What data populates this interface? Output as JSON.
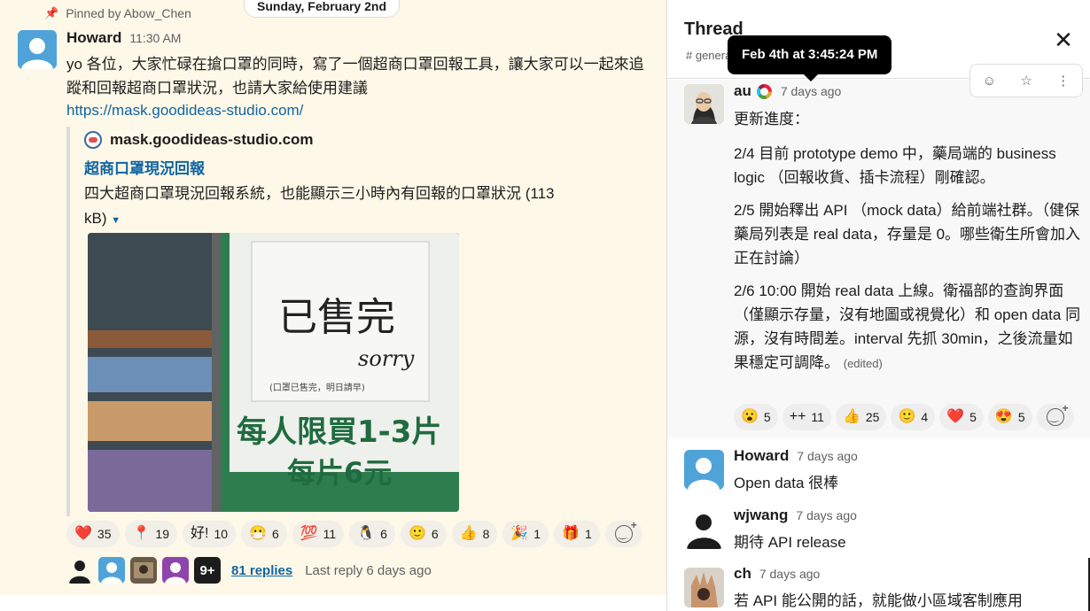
{
  "channel": {
    "pinned_by": "Pinned by Abow_Chen",
    "date_divider": "Sunday, February 2nd",
    "message": {
      "author": "Howard",
      "time": "11:30 AM",
      "text": "yo 各位，大家忙碌在搶口罩的同時，寫了一個超商口罩回報工具，讓大家可以一起來追蹤和回報超商口罩狀況，也請大家給使用建議",
      "link": "https://mask.goodideas-studio.com/"
    },
    "unfurl": {
      "site": "mask.goodideas-studio.com",
      "title": "超商口罩現況回報",
      "description": "四大超商口罩現況回報系統，也能顯示三小時內有回報的口罩狀況",
      "size": "(113 kB)",
      "image_sign": {
        "sold_out": "已售完",
        "sorry": "sorry",
        "note": "(口罩已售完，明日請早)",
        "limit": "每人限買1-3片",
        "price": "每片6元"
      }
    },
    "reactions": [
      {
        "icon": "heart",
        "emoji": "❤️",
        "count": "35"
      },
      {
        "icon": "pushpin-red",
        "emoji": "📍",
        "count": "19"
      },
      {
        "icon": "good-text",
        "emoji": "好!",
        "count": "10"
      },
      {
        "icon": "face-mask-globe",
        "emoji": "😷",
        "count": "6"
      },
      {
        "icon": "hundred",
        "emoji": "💯",
        "count": "11"
      },
      {
        "icon": "penguin",
        "emoji": "🐧",
        "count": "6"
      },
      {
        "icon": "slightly-smiling",
        "emoji": "🙂",
        "count": "6"
      },
      {
        "icon": "thumbs-up",
        "emoji": "👍",
        "count": "8"
      },
      {
        "icon": "party-hat",
        "emoji": "🎉",
        "count": "1"
      },
      {
        "icon": "gift",
        "emoji": "🎁",
        "count": "1"
      }
    ],
    "replies": {
      "more_count": "9+",
      "link": "81 replies",
      "last": "Last reply 6 days ago"
    }
  },
  "thread": {
    "title": "Thread",
    "channel": "# general",
    "tooltip": "Feb 4th at 3:45:24 PM",
    "parent": {
      "author": "au",
      "time": "7 days ago",
      "lines": [
        "更新進度：",
        "2/4 目前 prototype demo 中，藥局端的 business logic （回報收貨、插卡流程）剛確認。",
        "2/5 開始釋出 API （mock data）給前端社群。（健保藥局列表是 real data，存量是 0。哪些衛生所會加入正在討論）",
        "2/6 10:00 開始 real data 上線。衛福部的查詢界面（僅顯示存量，沒有地圖或視覺化）和 open data 同源，沒有時間差。interval 先抓 30min，之後流量如果穩定可調降。"
      ],
      "edited": "(edited)",
      "reactions": [
        {
          "icon": "hushed-face",
          "emoji": "😮",
          "count": "5"
        },
        {
          "icon": "plus-plus",
          "emoji": "++",
          "count": "11"
        },
        {
          "icon": "thumbs-up",
          "emoji": "👍",
          "count": "25"
        },
        {
          "icon": "slightly-smiling",
          "emoji": "🙂",
          "count": "4"
        },
        {
          "icon": "heart",
          "emoji": "❤️",
          "count": "5"
        },
        {
          "icon": "heart-eyes",
          "emoji": "😍",
          "count": "5"
        }
      ]
    },
    "replies": [
      {
        "author": "Howard",
        "time": "7 days ago",
        "text": "Open data 很棒"
      },
      {
        "author": "wjwang",
        "time": "7 days ago",
        "text": "期待 API release"
      },
      {
        "author": "ch",
        "time": "7 days ago",
        "text": "若 API 能公開的話，就能做小區域客制應用"
      }
    ]
  },
  "colors": {
    "link": "#1264a3",
    "channel_bg": "#fdf8e7",
    "pin": "#e8912d"
  }
}
